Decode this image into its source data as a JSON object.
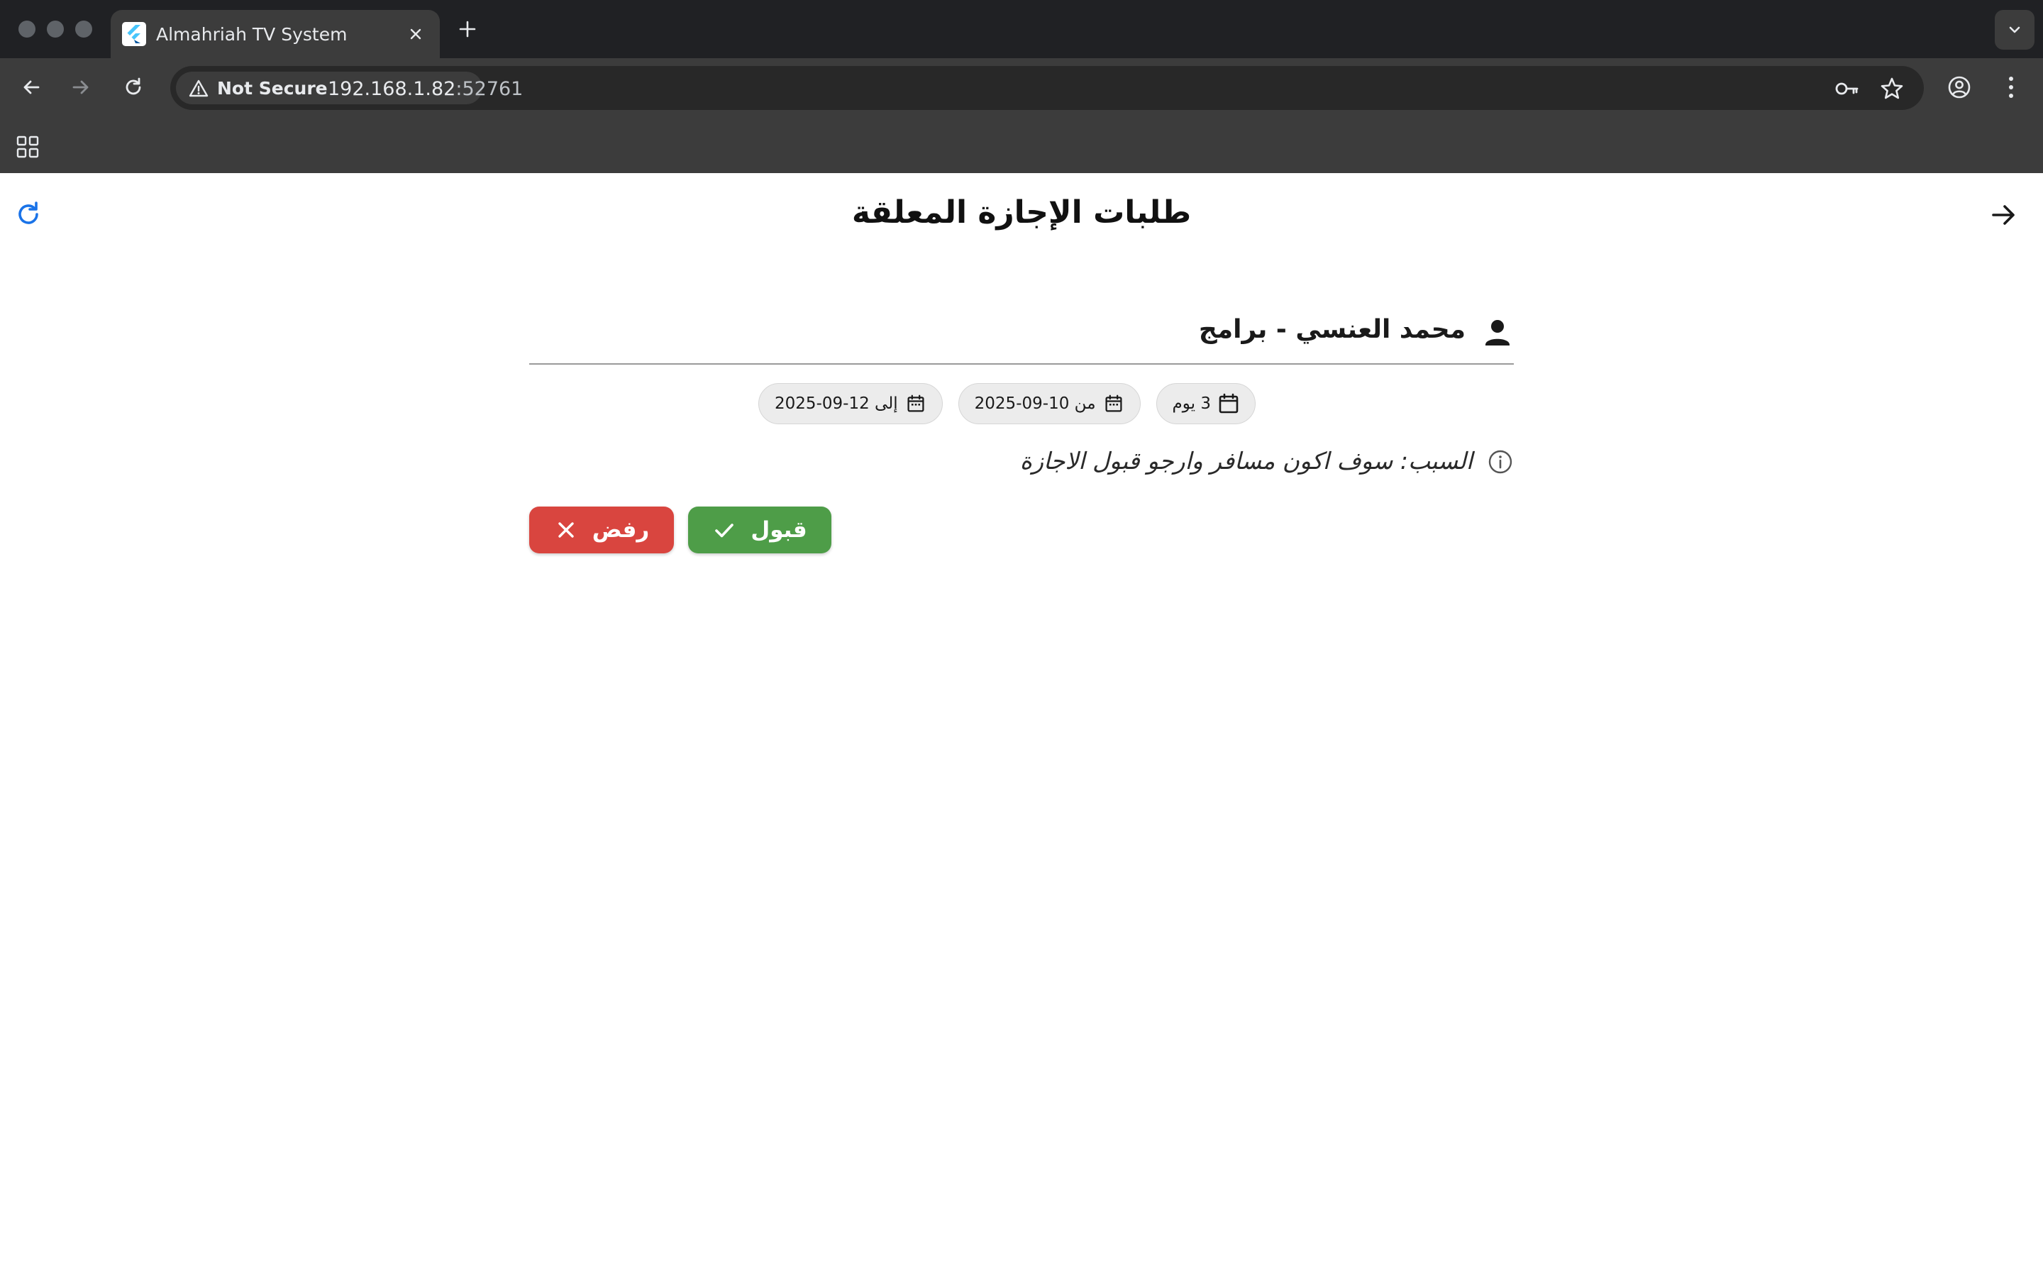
{
  "browser": {
    "tab_title": "Almahriah TV System",
    "security_label": "Not Secure",
    "url_host": "192.168.1.82",
    "url_port": ":52761"
  },
  "page": {
    "title": "طلبات الإجازة المعلقة"
  },
  "request": {
    "employee": "محمد العنسي - برامج",
    "duration": "3 يوم",
    "from": "من 10-09-2025",
    "to": "إلى 12-09-2025",
    "reason": "السبب: سوف اكون مسافر وارجو قبول الاجازة"
  },
  "actions": {
    "accept_label": "قبول",
    "reject_label": "رفض"
  },
  "colors": {
    "accept": "#4e9d48",
    "reject": "#d9453f",
    "refresh_icon": "#1a73e8",
    "chrome_dark": "#202124",
    "chrome_toolbar": "#3c3c3c"
  },
  "icons": {
    "refresh": "refresh-icon",
    "back": "arrow-right-icon",
    "person": "person-icon",
    "calendar": "calendar-icon",
    "info": "info-icon",
    "accept": "check-icon",
    "reject": "close-icon"
  }
}
